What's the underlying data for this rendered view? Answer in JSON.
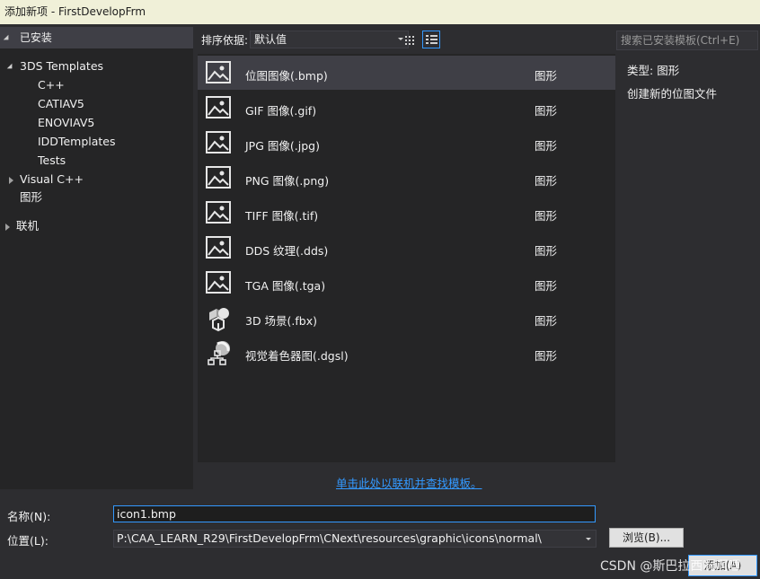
{
  "window": {
    "title": "添加新项 - FirstDevelopFrm"
  },
  "left_panel": {
    "header": "已安装",
    "tree": [
      {
        "label": "3DS Templates",
        "expander": "open"
      },
      {
        "label": "C++"
      },
      {
        "label": "CATIAV5"
      },
      {
        "label": "ENOVIAV5"
      },
      {
        "label": "IDDTemplates"
      },
      {
        "label": "Tests"
      },
      {
        "label": "Visual C++",
        "expander": "closed"
      },
      {
        "label": "图形",
        "selected": true
      },
      {
        "label": "联机",
        "expander": "closed"
      }
    ]
  },
  "toolbar": {
    "sort_label": "排序依据:",
    "sort_value": "默认值",
    "search_placeholder": "搜索已安装模板(Ctrl+E)"
  },
  "templates": [
    {
      "name": "位图图像(.bmp)",
      "category": "图形",
      "icon": "image-icon",
      "selected": true
    },
    {
      "name": "GIF 图像(.gif)",
      "category": "图形",
      "icon": "image-icon"
    },
    {
      "name": "JPG 图像(.jpg)",
      "category": "图形",
      "icon": "image-icon"
    },
    {
      "name": "PNG 图像(.png)",
      "category": "图形",
      "icon": "image-icon"
    },
    {
      "name": "TIFF 图像(.tif)",
      "category": "图形",
      "icon": "image-icon"
    },
    {
      "name": "DDS 纹理(.dds)",
      "category": "图形",
      "icon": "image-icon"
    },
    {
      "name": "TGA 图像(.tga)",
      "category": "图形",
      "icon": "image-icon"
    },
    {
      "name": "3D 场景(.fbx)",
      "category": "图形",
      "icon": "3d-scene-icon"
    },
    {
      "name": "视觉着色器图(.dgsl)",
      "category": "图形",
      "icon": "shader-graph-icon"
    }
  ],
  "details": {
    "type_label": "类型:",
    "type_value": "图形",
    "description": "创建新的位图文件"
  },
  "online_link": "单击此处以联机并查找模板。",
  "form": {
    "name_label": "名称(N):",
    "name_value": "icon1.bmp",
    "location_label": "位置(L):",
    "location_value": "P:\\CAA_LEARN_R29\\FirstDevelopFrm\\CNext\\resources\\graphic\\icons\\normal\\",
    "browse_label": "浏览(B)...",
    "add_label": "添加(A)"
  },
  "watermark": "CSDN @斯巴拉西啊啊哩"
}
